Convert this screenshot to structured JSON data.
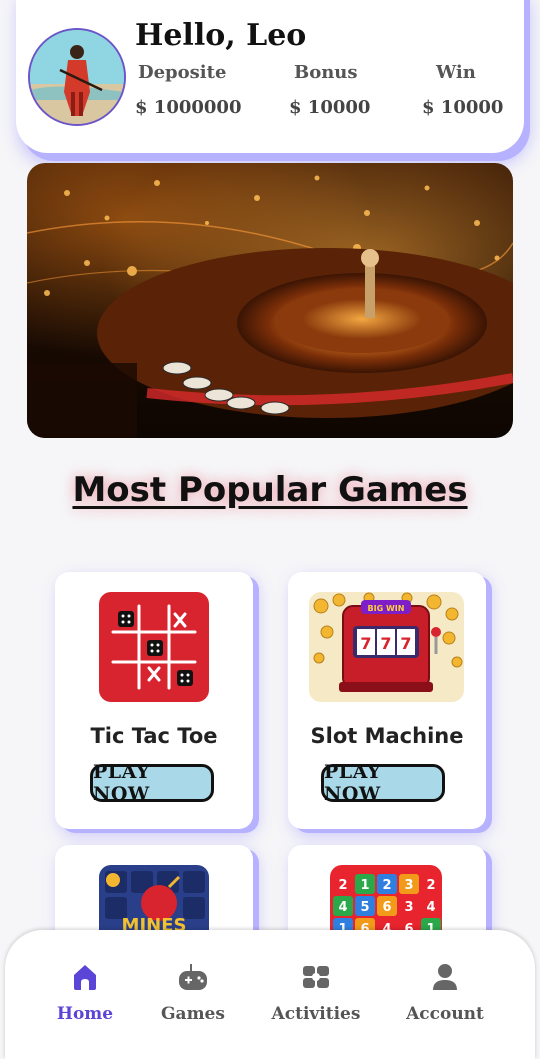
{
  "header": {
    "greeting": "Hello, Leo",
    "stats": [
      {
        "label": "Deposite",
        "value": "$ 1000000"
      },
      {
        "label": "Bonus",
        "value": "$ 10000"
      },
      {
        "label": "Win",
        "value": "$ 10000"
      }
    ]
  },
  "section_title": "Most Popular Games",
  "games": [
    {
      "title": "Tic Tac Toe",
      "button": "PLAY NOW"
    },
    {
      "title": "Slot Machine",
      "button": "PLAY NOW"
    }
  ],
  "slot_sign": "BIG WIN",
  "mines_sign": "MINES",
  "number_grid": [
    "2",
    "1",
    "2",
    "3",
    "2",
    "4",
    "5",
    "6",
    "3",
    "4",
    "1",
    "6",
    "4",
    "6",
    "1"
  ],
  "bottom_nav": {
    "items": [
      {
        "label": "Home",
        "icon": "home-icon",
        "active": true
      },
      {
        "label": "Games",
        "icon": "gamepad-icon",
        "active": false
      },
      {
        "label": "Activities",
        "icon": "activities-icon",
        "active": false
      },
      {
        "label": "Account",
        "icon": "user-icon",
        "active": false
      }
    ]
  },
  "colors": {
    "accent": "#5b45d6",
    "card_shadow": "#b7b2ff",
    "button_bg": "#a9d9e8",
    "tic_tac_toe_bg": "#d8242e"
  }
}
